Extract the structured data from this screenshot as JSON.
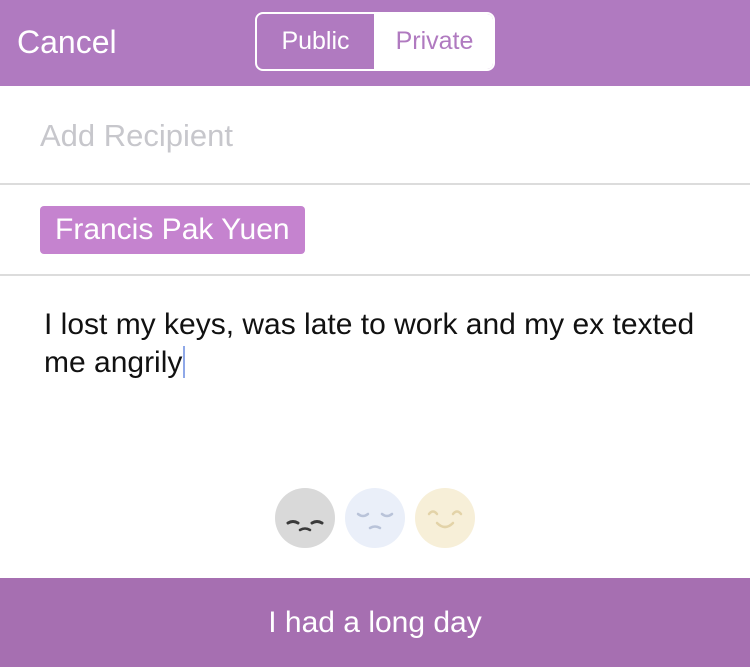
{
  "header": {
    "cancel_label": "Cancel",
    "segments": [
      {
        "label": "Public",
        "selected": false
      },
      {
        "label": "Private",
        "selected": true
      }
    ]
  },
  "recipient": {
    "placeholder": "Add Recipient",
    "value": ""
  },
  "recipients": [
    {
      "name": "Francis Pak Yuen"
    }
  ],
  "message": {
    "text": "I lost my keys, was late to work and my ex texted me angrily"
  },
  "moods": [
    {
      "name": "sad-face-icon",
      "color": "#d9d9d9",
      "selected": true
    },
    {
      "name": "pensive-face-icon",
      "color": "#eaeff9",
      "selected": false
    },
    {
      "name": "happy-face-icon",
      "color": "#f7efd8",
      "selected": false
    }
  ],
  "submit": {
    "label": "I had a long day"
  },
  "colors": {
    "header": "#b07ac0",
    "tag": "#c583cf",
    "submit_bar": "#a66fb1"
  }
}
